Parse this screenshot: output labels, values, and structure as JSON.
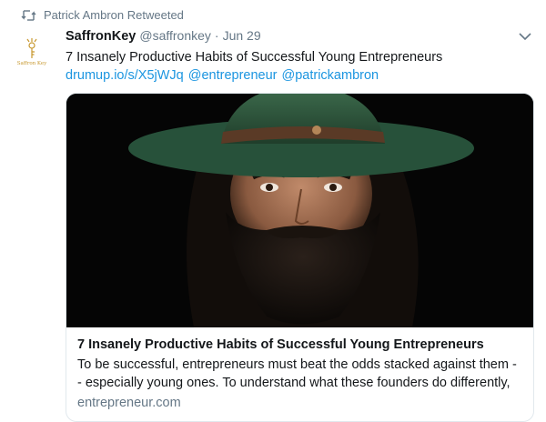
{
  "retweet": {
    "icon": "retweet-icon",
    "label": "Patrick Ambron Retweeted"
  },
  "tweet": {
    "avatar_text": "Saffron Key",
    "display_name": "SaffronKey",
    "handle": "@saffronkey",
    "separator": "·",
    "date": "Jun 29",
    "text": "7 Insanely Productive Habits of Successful Young Entrepreneurs",
    "links": [
      "drumup.io/s/X5jWJq",
      "@entrepreneur",
      "@patrickambron"
    ],
    "menu_icon": "chevron-down-icon"
  },
  "card": {
    "title": "7 Insanely Productive Habits of Successful Young Entrepreneurs",
    "description": "To be successful, entrepreneurs must beat the odds stacked against them - - especially young ones. To understand what these founders do differently,",
    "domain": "entrepreneur.com"
  },
  "colors": {
    "link": "#1b95e0",
    "muted": "#657786",
    "text": "#14171a",
    "border": "#e1e8ed",
    "avatar_gold": "#c7982f"
  }
}
